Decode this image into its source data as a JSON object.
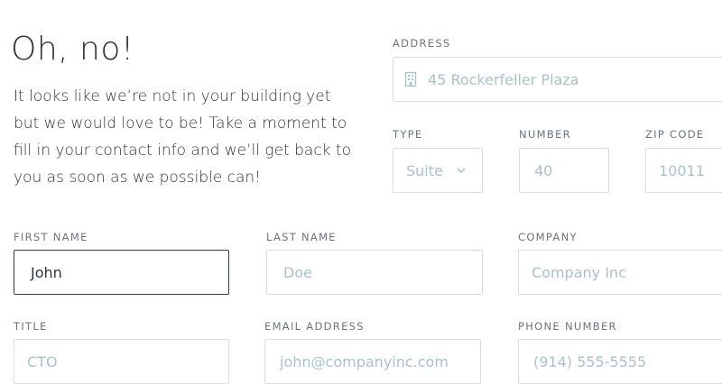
{
  "intro": {
    "headline": "Oh, no!",
    "message": "It looks like we’re not in your building yet but we would love to be! Take a moment to fill in your contact info and we’ll get back to you as soon as we possible can!"
  },
  "address": {
    "label": "ADDRESS",
    "placeholder": "45 Rockerfeller Plaza",
    "icon": "building-icon"
  },
  "type": {
    "label": "TYPE",
    "selected": "Suite",
    "icon": "chevron-down-icon"
  },
  "number": {
    "label": "NUMBER",
    "placeholder": "40"
  },
  "zip": {
    "label": "ZIP CODE",
    "placeholder": "10011"
  },
  "first_name": {
    "label": "FIRST NAME",
    "value": "John"
  },
  "last_name": {
    "label": "LAST NAME",
    "placeholder": "Doe"
  },
  "company": {
    "label": "COMPANY",
    "placeholder": "Company Inc"
  },
  "title": {
    "label": "TITLE",
    "placeholder": "CTO"
  },
  "email": {
    "label": "EMAIL ADDRESS",
    "placeholder": "john@companyinc.com"
  },
  "phone": {
    "label": "PHONE NUMBER",
    "placeholder": "(914) 555-5555"
  },
  "colors": {
    "border": "#d9dde2",
    "focus_border": "#2f3a4f",
    "placeholder": "#a9c3c9",
    "label": "#6c7480"
  }
}
